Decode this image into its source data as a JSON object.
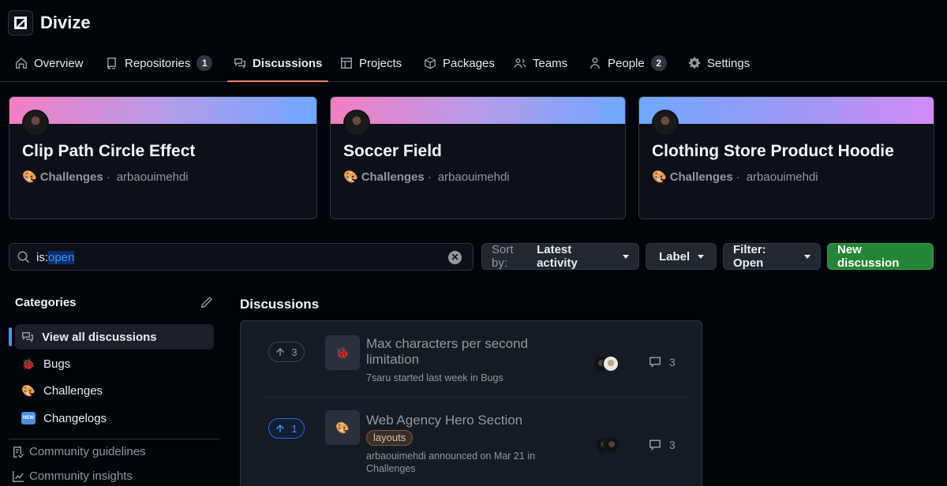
{
  "org": {
    "name": "Divize"
  },
  "nav": {
    "overview": "Overview",
    "repositories": "Repositories",
    "repositories_count": "1",
    "discussions": "Discussions",
    "projects": "Projects",
    "packages": "Packages",
    "teams": "Teams",
    "people": "People",
    "people_count": "2",
    "settings": "Settings"
  },
  "pinned": [
    {
      "title": "Clip Path Circle Effect",
      "category": "Challenges",
      "sep": "·",
      "author": "arbaouimehdi"
    },
    {
      "title": "Soccer Field",
      "category": "Challenges",
      "sep": "·",
      "author": "arbaouimehdi"
    },
    {
      "title": "Clothing Store Product Hoodie",
      "category": "Challenges",
      "sep": "·",
      "author": "arbaouimehdi"
    }
  ],
  "search": {
    "prefix": "is:",
    "value": "open",
    "clear_glyph": "✕"
  },
  "sort": {
    "label": "Sort by:",
    "value": "Latest activity"
  },
  "label_button": "Label",
  "filter_button": "Filter: Open",
  "new_discussion": "New discussion",
  "categories": {
    "title": "Categories",
    "items": [
      {
        "label": "View all discussions"
      },
      {
        "label": "Bugs",
        "emoji": "🐞"
      },
      {
        "label": "Challenges",
        "emoji": "🎨"
      },
      {
        "label": "Changelogs",
        "badge": "NEW"
      }
    ],
    "links": [
      {
        "label": "Community guidelines"
      },
      {
        "label": "Community insights"
      }
    ]
  },
  "discussions": {
    "title": "Discussions",
    "items": [
      {
        "votes": "3",
        "emoji": "🐞",
        "title": "Max characters per second limitation",
        "meta": "7saru started last week in Bugs",
        "comments": "3"
      },
      {
        "votes": "1",
        "emoji": "🎨",
        "title": "Web Agency Hero Section",
        "label": "layouts",
        "meta": "arbaouimehdi announced on Mar 21 in Challenges",
        "comments": "3"
      }
    ]
  },
  "colors": {
    "accent": "#f78166",
    "link": "#4493f8",
    "primary": "#238636",
    "gradient_1": [
      "#f47ec1",
      "#6fa8ff"
    ],
    "gradient_2": [
      "#f47ec1",
      "#6fa8ff"
    ],
    "gradient_3": [
      "#6fa8ff",
      "#d28cf5"
    ]
  }
}
